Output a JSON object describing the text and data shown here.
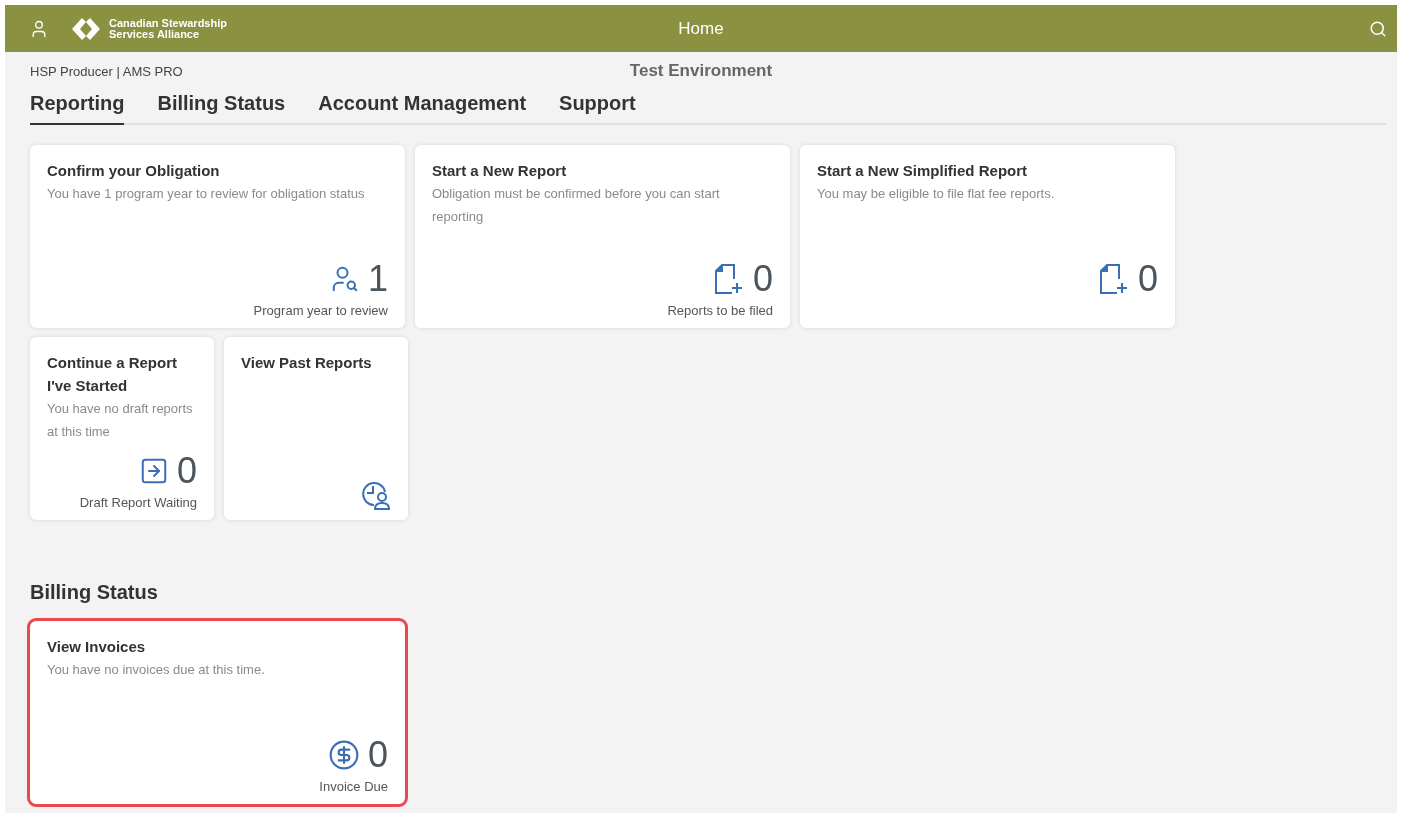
{
  "header": {
    "logo_lines": [
      "Canadian Stewardship",
      "Services Alliance"
    ],
    "title": "Home"
  },
  "subheader": {
    "account": "HSP Producer | AMS PRO",
    "environment": "Test Environment"
  },
  "tabs": [
    {
      "label": "Reporting",
      "selected": true
    },
    {
      "label": "Billing Status",
      "selected": false
    },
    {
      "label": "Account Management",
      "selected": false
    },
    {
      "label": "Support",
      "selected": false
    }
  ],
  "reporting_rows": [
    {
      "compact": false,
      "tiles": [
        {
          "kind": "review",
          "title": "Confirm your Obligation",
          "description": "You have 1 program year to review for obligation status",
          "count": "1",
          "footer": "Program year to review",
          "highlighted": false
        },
        {
          "kind": "new-report",
          "title": "Start a New Report",
          "description": "Obligation must be confirmed before you can start reporting",
          "count": "0",
          "footer": "Reports to be filed",
          "highlighted": false
        },
        {
          "kind": "new-report",
          "title": "Start a New Simplified Report",
          "description": "You may be eligible to file flat fee reports.",
          "count": "0",
          "highlighted": false
        }
      ]
    },
    {
      "compact": true,
      "tiles": [
        {
          "kind": "draft",
          "title": "Continue a Report I've Started",
          "description": "You have no draft reports at this time",
          "count": "0",
          "footer": "Draft Report Waiting",
          "highlighted": false
        },
        {
          "kind": "history",
          "title": "View Past Reports",
          "highlighted": false
        }
      ]
    }
  ],
  "billing_section": {
    "heading": "Billing Status",
    "tiles": [
      {
        "kind": "invoice",
        "title": "View Invoices",
        "description": "You have no invoices due at this time.",
        "count": "0",
        "footer": "Invoice Due",
        "highlighted": true
      }
    ]
  }
}
